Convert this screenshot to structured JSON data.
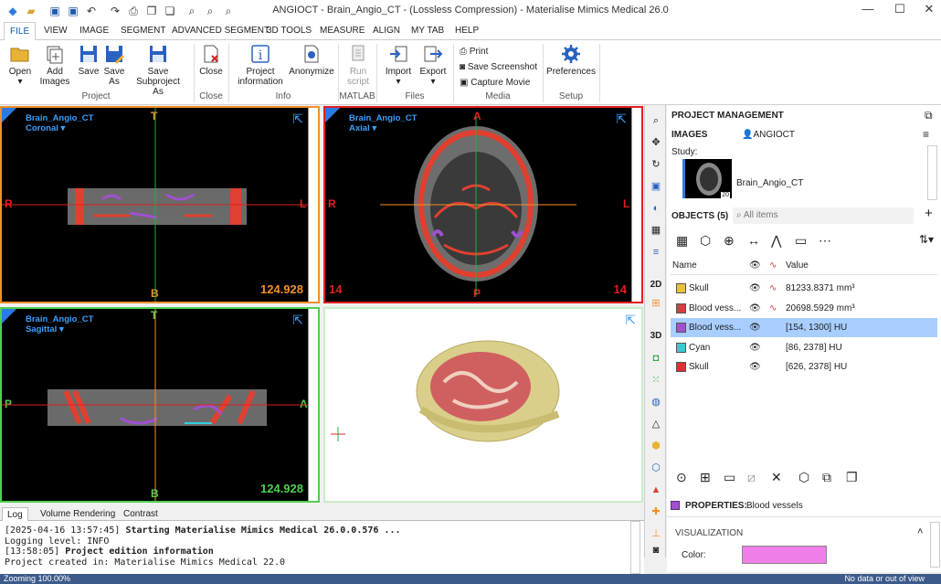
{
  "window": {
    "title": "ANGIOCT - Brain_Angio_CT -  (Lossless Compression) - Materialise Mimics Medical 26.0"
  },
  "menu_tabs": [
    "FILE",
    "VIEW",
    "IMAGE",
    "SEGMENT",
    "ADVANCED SEGMENT",
    "3D TOOLS",
    "MEASURE",
    "ALIGN",
    "MY TAB",
    "HELP"
  ],
  "ribbon": {
    "open": "Open",
    "add_images_1": "Add",
    "add_images_2": "Images",
    "save": "Save",
    "save_as_1": "Save",
    "save_as_2": "As",
    "save_sub_1": "Save Subproject",
    "save_sub_2": "As",
    "close": "Close",
    "project_info_1": "Project",
    "project_info_2": "information",
    "anonymize": "Anonymize",
    "run_script_1": "Run",
    "run_script_2": "script",
    "import": "Import",
    "export": "Export",
    "print": "Print",
    "save_screenshot": "Save Screenshot",
    "capture_movie": "Capture Movie",
    "preferences": "Preferences",
    "groups": {
      "project": "Project",
      "close": "Close",
      "info": "Info",
      "matlab": "MATLAB",
      "files": "Files",
      "media": "Media",
      "setup": "Setup"
    }
  },
  "viewports": {
    "coronal": {
      "name": "Brain_Angio_CT",
      "view": "Coronal",
      "top": "T",
      "bottom": "B",
      "left": "R",
      "right": "L",
      "value": "124.928"
    },
    "axial": {
      "name": "Brain_Angio_CT",
      "view": "Axial",
      "top": "A",
      "bottom": "P",
      "left": "R",
      "right": "L",
      "num_left": "14",
      "num_right": "14"
    },
    "sagittal": {
      "name": "Brain_Angio_CT",
      "view": "Sagittal",
      "top": "T",
      "bottom": "B",
      "left": "P",
      "right": "A",
      "value": "124.928"
    },
    "three_d": {}
  },
  "vtools": {
    "label_2d": "2D",
    "label_3d": "3D"
  },
  "project_panel": {
    "title": "PROJECT MANAGEMENT",
    "images_label": "IMAGES",
    "user": "ANGIOCT",
    "study_label": "Study:",
    "study_name": "Brain_Angio_CT",
    "thumb_badge": "20",
    "objects_label": "OBJECTS (5)",
    "search_placeholder": "All items",
    "col_name": "Name",
    "col_value": "Value",
    "objects": [
      {
        "name": "Skull",
        "value": "81233.8371 mm³",
        "color": "#e8c040",
        "kind": "3d"
      },
      {
        "name": "Blood vess...",
        "value": "20698.5929 mm³",
        "color": "#d04040",
        "kind": "3d"
      },
      {
        "name": "Blood vess...",
        "value": "[154, 1300] HU",
        "color": "#a050d0",
        "kind": "mask"
      },
      {
        "name": "Cyan",
        "value": "[86, 2378] HU",
        "color": "#40c8d0",
        "kind": "mask"
      },
      {
        "name": "Skull",
        "value": "[626, 2378] HU",
        "color": "#e03030",
        "kind": "mask"
      }
    ],
    "properties_label": "PROPERTIES:",
    "properties_target": "Blood vessels",
    "visualization_label": "VISUALIZATION",
    "color_label": "Color:",
    "color_value": "#f07ee8"
  },
  "log": {
    "tabs": [
      "Log",
      "Volume Rendering",
      "Contrast"
    ],
    "lines": [
      {
        "prefix": "[2025-04-16 13:57:45] ",
        "text": "Starting Materialise Mimics Medical 26.0.0.576 ..."
      },
      {
        "prefix": "    Logging level: INFO",
        "text": ""
      },
      {
        "prefix": "[13:58:05] ",
        "text": "Project edition information"
      },
      {
        "prefix": "    Project created in: Materialise Mimics Medical 22.0",
        "text": ""
      }
    ]
  },
  "status": {
    "left": "Zooming 100.00%",
    "right": "No data or out of view"
  }
}
